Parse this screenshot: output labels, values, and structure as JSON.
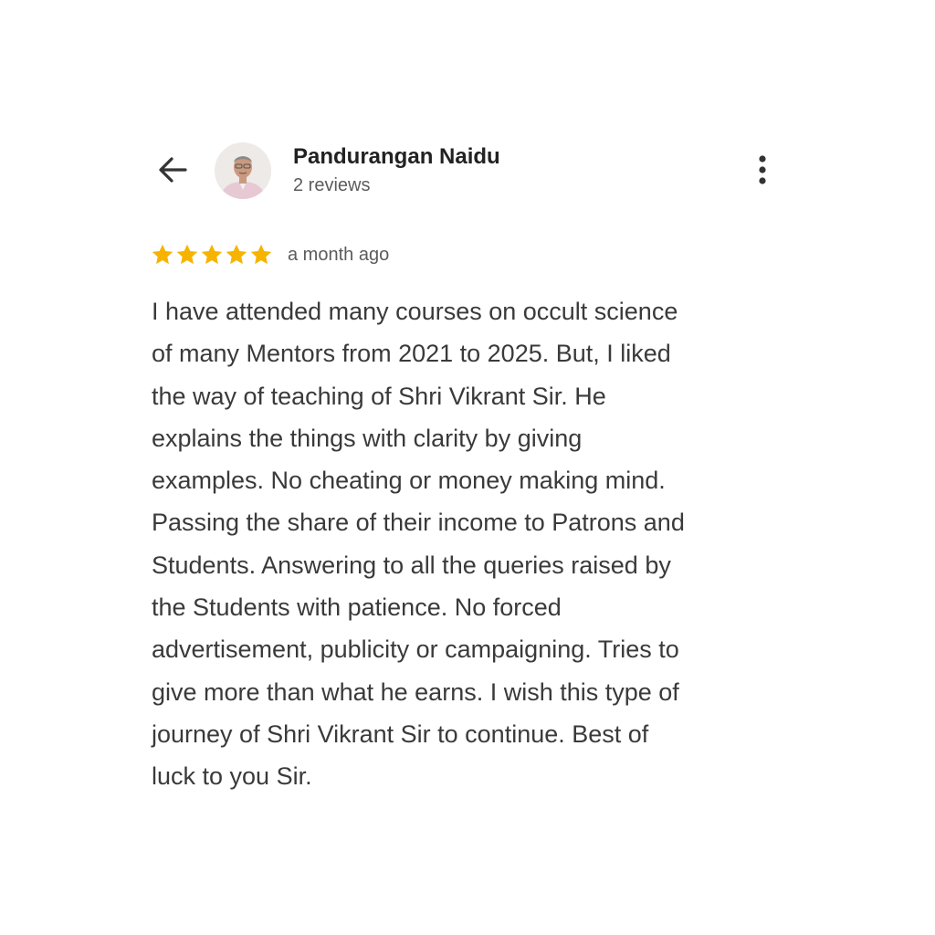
{
  "header": {
    "back_icon": "arrow-left-icon",
    "reviewer_name": "Pandurangan Naidu",
    "review_count": "2 reviews",
    "menu_icon": "more-vert-icon"
  },
  "review": {
    "rating": 5,
    "rating_max": 5,
    "star_color": "#F6B400",
    "time": "a month ago",
    "lines": [
      "I have attended many courses on occult science",
      "of many Mentors from 2021 to 2025. But, I liked",
      "the way of teaching of Shri Vikrant Sir. He",
      "explains the things with clarity by giving",
      "examples. No cheating or money making mind.",
      "Passing the share of their income to Patrons and",
      "Students. Answering to all the queries raised by",
      "the Students with patience. No forced",
      "advertisement, publicity or campaigning. Tries to",
      "give more than what he earns. I wish this type of",
      "journey of Shri Vikrant Sir to continue. Best of",
      "luck to you Sir."
    ]
  }
}
